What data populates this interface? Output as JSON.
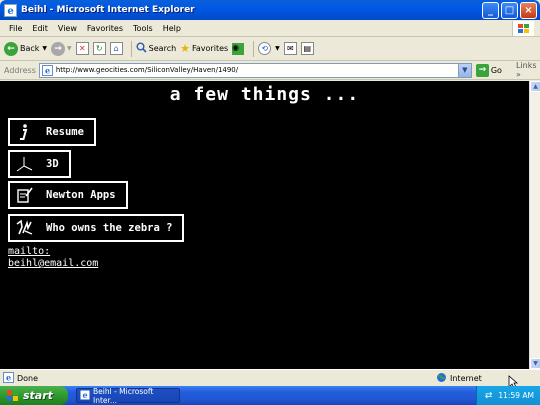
{
  "window": {
    "title": "Beihl - Microsoft Internet Explorer",
    "controls": [
      "minimize",
      "maximize",
      "close"
    ]
  },
  "menu": [
    "File",
    "Edit",
    "View",
    "Favorites",
    "Tools",
    "Help"
  ],
  "toolbar": {
    "back_label": "Back",
    "search_label": "Search",
    "favorites_label": "Favorites"
  },
  "address": {
    "label": "Address",
    "url": "http://www.geocities.com/SiliconValley/Haven/1490/",
    "go_label": "Go",
    "links_label": "Links"
  },
  "page": {
    "heading": "a few things ...",
    "links": [
      {
        "label": "Resume",
        "icon": "info-i-icon"
      },
      {
        "label": "3D",
        "icon": "axes-3d-icon"
      },
      {
        "label": "Newton Apps",
        "icon": "newton-pad-icon"
      },
      {
        "label": "Who owns the zebra ?",
        "icon": "zebra-icon"
      }
    ],
    "mailto_label": "mailto:",
    "email": "beihl@email.com"
  },
  "status": {
    "text": "Done",
    "zone": "Internet"
  },
  "taskbar": {
    "start_label": "start",
    "task_label": "Beihl - Microsoft Inter...",
    "clock": "11:59 AM"
  },
  "colors": {
    "page_bg": "#000000",
    "page_text": "#FFFFFF",
    "titlebar": "#0058E6",
    "start_green": "#2E9A2E"
  }
}
